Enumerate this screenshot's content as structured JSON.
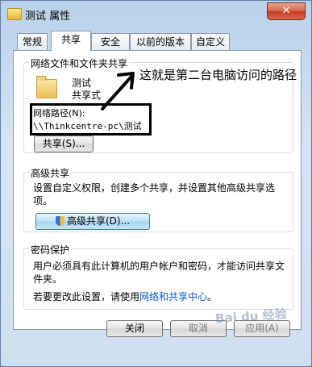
{
  "window": {
    "title": "测试 属性",
    "close_glyph": "✕"
  },
  "tabs": [
    {
      "label": "常规"
    },
    {
      "label": "共享"
    },
    {
      "label": "安全"
    },
    {
      "label": "以前的版本"
    },
    {
      "label": "自定义"
    }
  ],
  "active_tab": "共享",
  "network_sharing": {
    "section_title": "网络文件和文件夹共享",
    "folder_name": "测试",
    "share_status": "共享式",
    "path_label": "网络路径(N):",
    "path_value": "\\\\Thinkcentre-pc\\测试",
    "share_button": "共享(S)..."
  },
  "advanced_sharing": {
    "section_title": "高级共享",
    "description": "设置自定义权限，创建多个共享，并设置其他高级共享选项。",
    "button": "高级共享(D)..."
  },
  "password_protection": {
    "section_title": "密码保护",
    "description": "用户必须具有此计算机的用户帐户和密码，才能访问共享文件夹。",
    "change_prefix": "若要更改此设置，请使用",
    "change_link": "网络和共享中心",
    "change_suffix": "。"
  },
  "annotation": "这就是第二台电脑访问的路径",
  "footer": {
    "close": "关闭",
    "cancel": "取消",
    "apply": "应用(A)"
  },
  "watermark": "Bai du 经验"
}
